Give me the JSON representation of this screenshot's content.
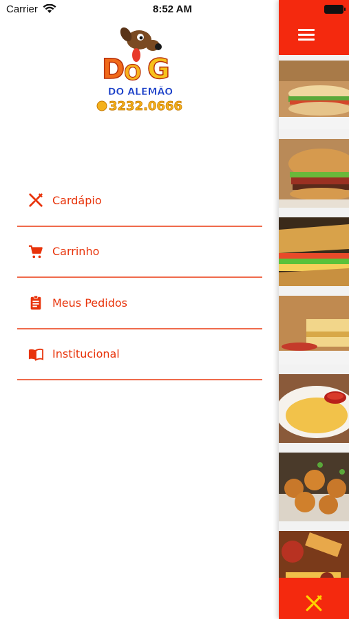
{
  "status_bar": {
    "carrier": "Carrier",
    "time": "8:52 AM"
  },
  "logo": {
    "brand_top": "DOG",
    "brand_bottom": "DO ALEMÃO",
    "phone": "3232.0666"
  },
  "menu": {
    "items": [
      {
        "label": "Cardápio",
        "icon": "fork-knife-icon"
      },
      {
        "label": "Carrinho",
        "icon": "cart-icon"
      },
      {
        "label": "Meus Pedidos",
        "icon": "clipboard-icon"
      },
      {
        "label": "Institucional",
        "icon": "book-icon"
      }
    ]
  },
  "colors": {
    "accent": "#f4290e",
    "menu_text": "#e8330a",
    "divider": "#ef6a4b"
  },
  "strip": {
    "tiles": [
      "sandwich",
      "burger-bacon",
      "grilled-sandwich",
      "toast-sausage",
      "fries-dip",
      "croquettes",
      "mixed-platter"
    ]
  }
}
